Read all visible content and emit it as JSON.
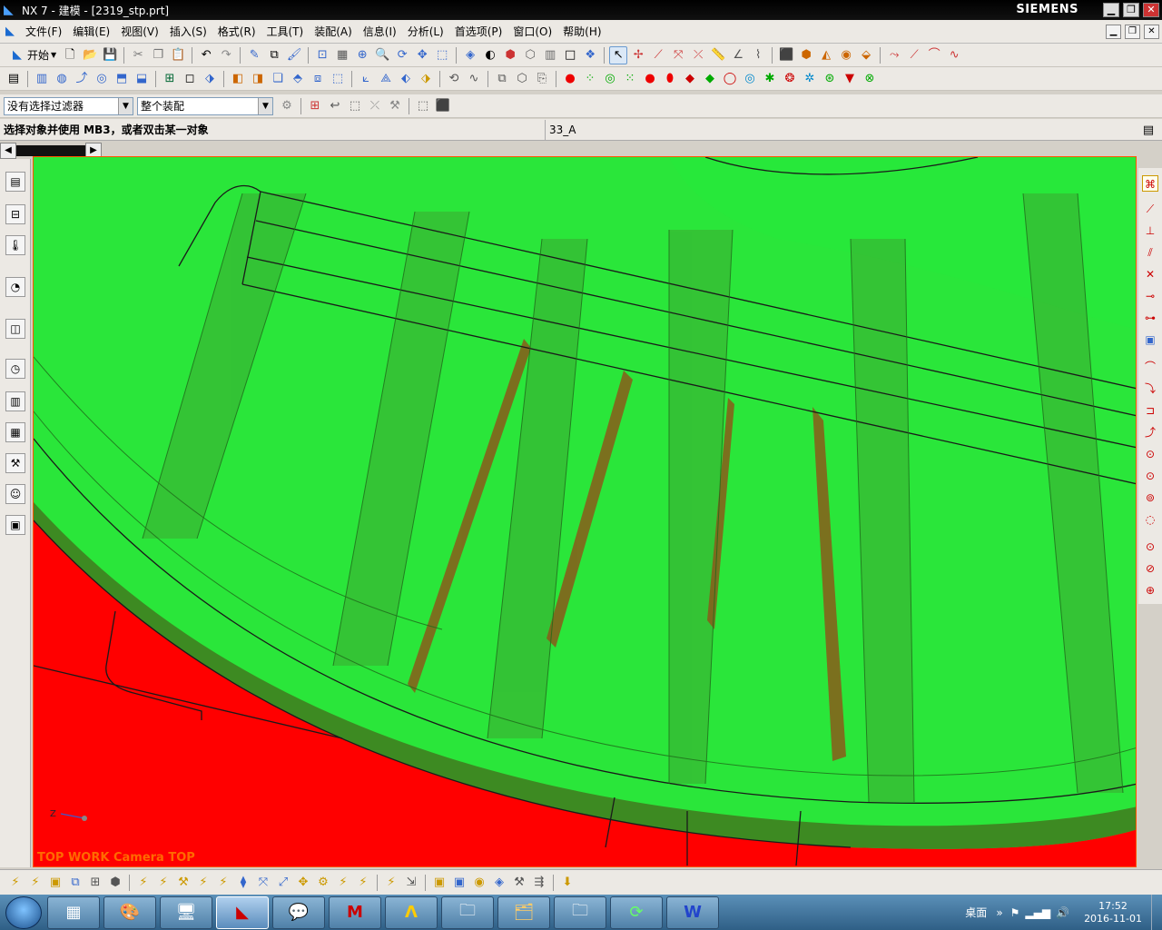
{
  "window": {
    "title": "NX 7 - 建模 - [2319_stp.prt]",
    "brand": "SIEMENS"
  },
  "menu": [
    "文件(F)",
    "编辑(E)",
    "视图(V)",
    "插入(S)",
    "格式(R)",
    "工具(T)",
    "装配(A)",
    "信息(I)",
    "分析(L)",
    "首选项(P)",
    "窗口(O)",
    "帮助(H)"
  ],
  "toolbar": {
    "start_label": "开始",
    "filter_value": "没有选择过滤器",
    "scope_value": "整个装配"
  },
  "cue": {
    "prompt": "选择对象并使用 MB3，或者双击某一对象",
    "status": "33_A"
  },
  "viewport": {
    "label": "TOP WORK Camera TOP",
    "axis_z": "Z",
    "colors": {
      "green_face": "#2ae63a",
      "red_face": "#ff0000",
      "brown_face": "#8a5a1a",
      "edge": "#1a1a1a"
    }
  },
  "taskbar": {
    "desktop_label": "桌面",
    "time": "17:52",
    "date": "2016-11-01"
  }
}
